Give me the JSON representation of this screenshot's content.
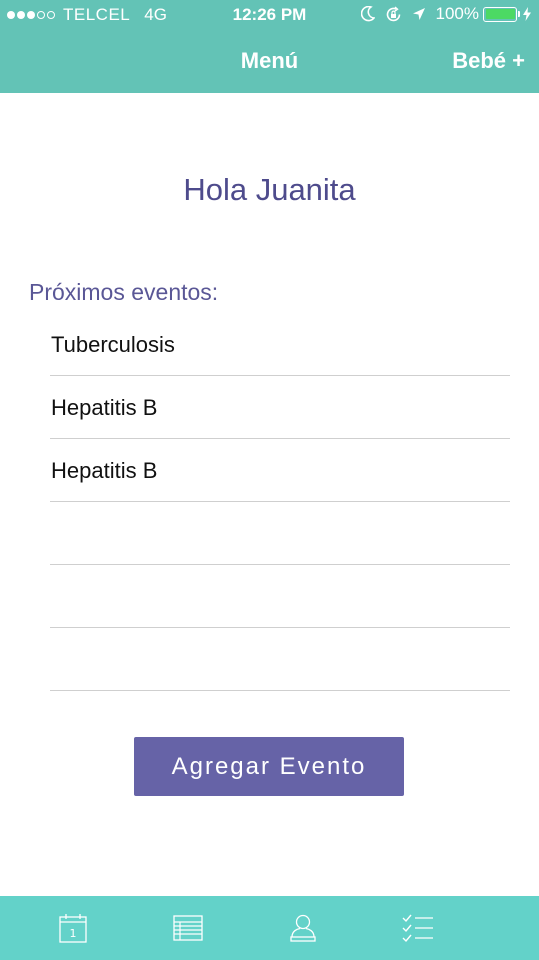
{
  "colors": {
    "header_bg": "#63c3b6",
    "tabbar_bg": "#63d2c9",
    "accent_purple": "#6663a7",
    "heading_purple": "#4e4b8c",
    "battery_green": "#4cd964"
  },
  "status_bar": {
    "carrier": "TELCEL",
    "network": "4G",
    "time": "12:26 PM",
    "battery": "100%",
    "signal_bars_filled": 3,
    "signal_bars_total": 5,
    "icons": [
      "moon-icon",
      "orientation-lock-icon",
      "location-arrow-icon",
      "battery-icon",
      "charging-icon"
    ]
  },
  "nav": {
    "title": "Menú",
    "right_label": "Bebé +"
  },
  "greeting": "Hola Juanita",
  "events_section": {
    "label": "Próximos eventos:",
    "items": [
      "Tuberculosis",
      "Hepatitis B",
      "Hepatitis B",
      "",
      "",
      ""
    ]
  },
  "add_button_label": "Agregar Evento",
  "tabbar": {
    "tabs": [
      {
        "icon": "calendar-icon",
        "calendar_day": "1"
      },
      {
        "icon": "list-icon"
      },
      {
        "icon": "profile-icon"
      },
      {
        "icon": "checklist-icon"
      }
    ]
  }
}
